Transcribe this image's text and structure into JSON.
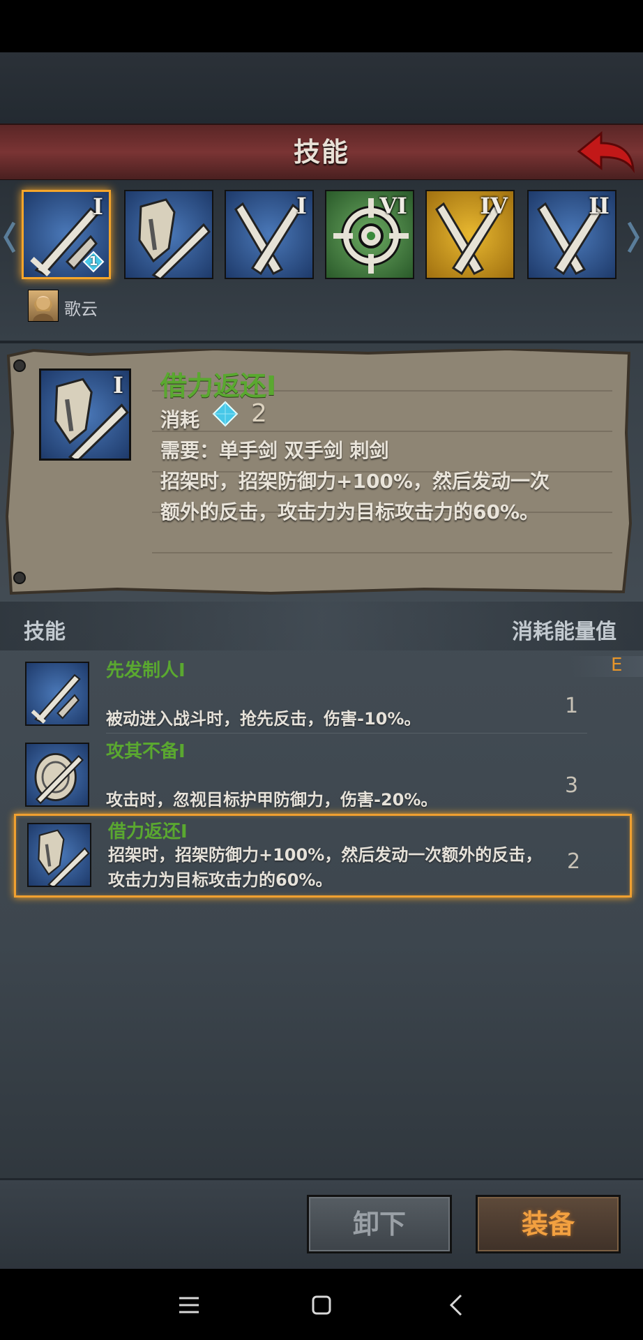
{
  "header": {
    "title": "技能"
  },
  "skill_slots": [
    {
      "roman": "I",
      "gem_count": "1",
      "icon": "sword-strike-icon"
    },
    {
      "roman": "",
      "icon": "shield-sword-icon"
    },
    {
      "roman": "I",
      "icon": "crossed-swords-icon"
    },
    {
      "roman": "VI",
      "icon": "crosshair-target-icon"
    },
    {
      "roman": "IV",
      "icon": "crossed-swords-icon"
    },
    {
      "roman": "II",
      "icon": "crossed-swords-icon"
    }
  ],
  "character": {
    "name": "歌云"
  },
  "detail": {
    "roman": "I",
    "title": "借力返还I",
    "cost_label": "消耗",
    "cost_value": "2",
    "requirement": "需要：单手剑  双手剑  刺剑",
    "desc_line1": "招架时，招架防御力+100%，然后发动一次",
    "desc_line2": "额外的反击，攻击力为目标攻击力的60%。"
  },
  "list_header": {
    "left": "技能",
    "right": "消耗能量值"
  },
  "equipped_badge": "E",
  "skills": [
    {
      "title": "先发制人I",
      "desc": "被动进入战斗时，抢先反击，伤害-10%。",
      "cost": "1"
    },
    {
      "title": "攻其不备I",
      "desc": "攻击时，忽视目标护甲防御力，伤害-20%。",
      "cost": "3"
    },
    {
      "title": "借力返还I",
      "desc": "招架时，招架防御力+100%，然后发动一次额外的反击，攻击力为目标攻击力的60%。",
      "cost": "2"
    }
  ],
  "buttons": {
    "unequip": "卸下",
    "equip": "装备"
  },
  "colors": {
    "accent": "#f5a52a",
    "skill_title": "#5aa830",
    "header_red": "#7a3434",
    "equip_text": "#f2a040"
  }
}
